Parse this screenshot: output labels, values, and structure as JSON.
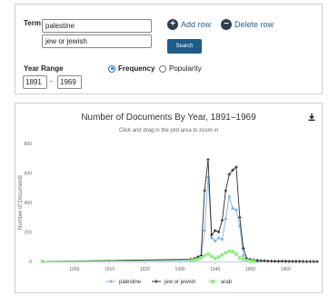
{
  "search": {
    "term_label": "Term",
    "terms": [
      "palestine",
      "jew or jewish"
    ],
    "add_row_label": "Add row",
    "delete_row_label": "Delete row",
    "search_button_label": "Search",
    "year_range_label": "Year Range",
    "year_from": "1891",
    "year_to": "1969",
    "year_dash": "-",
    "mode_options": [
      "Frequency",
      "Popularity"
    ],
    "mode_selected": "Frequency"
  },
  "icons": {
    "add": "plus-circle-icon",
    "delete": "minus-circle-icon",
    "download": "download-icon"
  },
  "colors": {
    "button": "#1f5c8a",
    "palestine": "#7fb3e6",
    "jew_or_jewish": "#2b2b2b",
    "arab": "#90ed7d"
  },
  "chart": {
    "title": "Number of Documents By Year, 1891–1969",
    "subtitle": "Click and drag in the plot area to zoom in"
  },
  "chart_data": {
    "type": "line",
    "title": "Number of Documents By Year, 1891–1969",
    "subtitle": "Click and drag in the plot area to zoom in",
    "xlabel": "",
    "ylabel": "Number of Documents",
    "xlim": [
      1891,
      1969
    ],
    "ylim": [
      0,
      800
    ],
    "x_ticks": [
      1900,
      1910,
      1920,
      1930,
      1940,
      1950,
      1960
    ],
    "y_ticks": [
      0,
      200,
      400,
      600,
      800
    ],
    "grid": false,
    "legend_position": "bottom",
    "series": [
      {
        "name": "palestine",
        "color": "#7fb3e6",
        "marker": "diamond",
        "x": [
          1891,
          1933,
          1934,
          1935,
          1936,
          1937,
          1938,
          1939,
          1940,
          1941,
          1942,
          1943,
          1944,
          1945,
          1946,
          1947,
          1948,
          1949,
          1950,
          1951,
          1952
        ],
        "y": [
          0,
          10,
          15,
          20,
          30,
          210,
          570,
          160,
          140,
          160,
          150,
          290,
          440,
          360,
          350,
          240,
          40,
          15,
          10,
          5,
          0
        ]
      },
      {
        "name": "jew or jewish",
        "color": "#2b2b2b",
        "marker": "plus",
        "x": [
          1891,
          1933,
          1934,
          1935,
          1936,
          1937,
          1938,
          1939,
          1940,
          1941,
          1942,
          1943,
          1944,
          1945,
          1946,
          1947,
          1948,
          1949,
          1950,
          1951,
          1952,
          1953,
          1954,
          1955,
          1956,
          1957,
          1958,
          1959,
          1960,
          1961,
          1962,
          1963,
          1964,
          1965,
          1966,
          1967,
          1968,
          1969
        ],
        "y": [
          0,
          15,
          20,
          30,
          40,
          480,
          690,
          180,
          210,
          200,
          280,
          480,
          590,
          620,
          640,
          300,
          90,
          20,
          15,
          10,
          8,
          5,
          5,
          3,
          3,
          2,
          2,
          2,
          2,
          1,
          1,
          1,
          1,
          0,
          0,
          0,
          0,
          0
        ]
      },
      {
        "name": "arab",
        "color": "#90ed7d",
        "marker": "square",
        "x": [
          1891,
          1933,
          1934,
          1935,
          1936,
          1937,
          1938,
          1939,
          1940,
          1941,
          1942,
          1943,
          1944,
          1945,
          1946,
          1947,
          1948,
          1949,
          1950,
          1951
        ],
        "y": [
          0,
          5,
          10,
          15,
          25,
          40,
          50,
          35,
          20,
          30,
          45,
          60,
          70,
          65,
          50,
          25,
          15,
          8,
          4,
          0
        ]
      }
    ]
  }
}
